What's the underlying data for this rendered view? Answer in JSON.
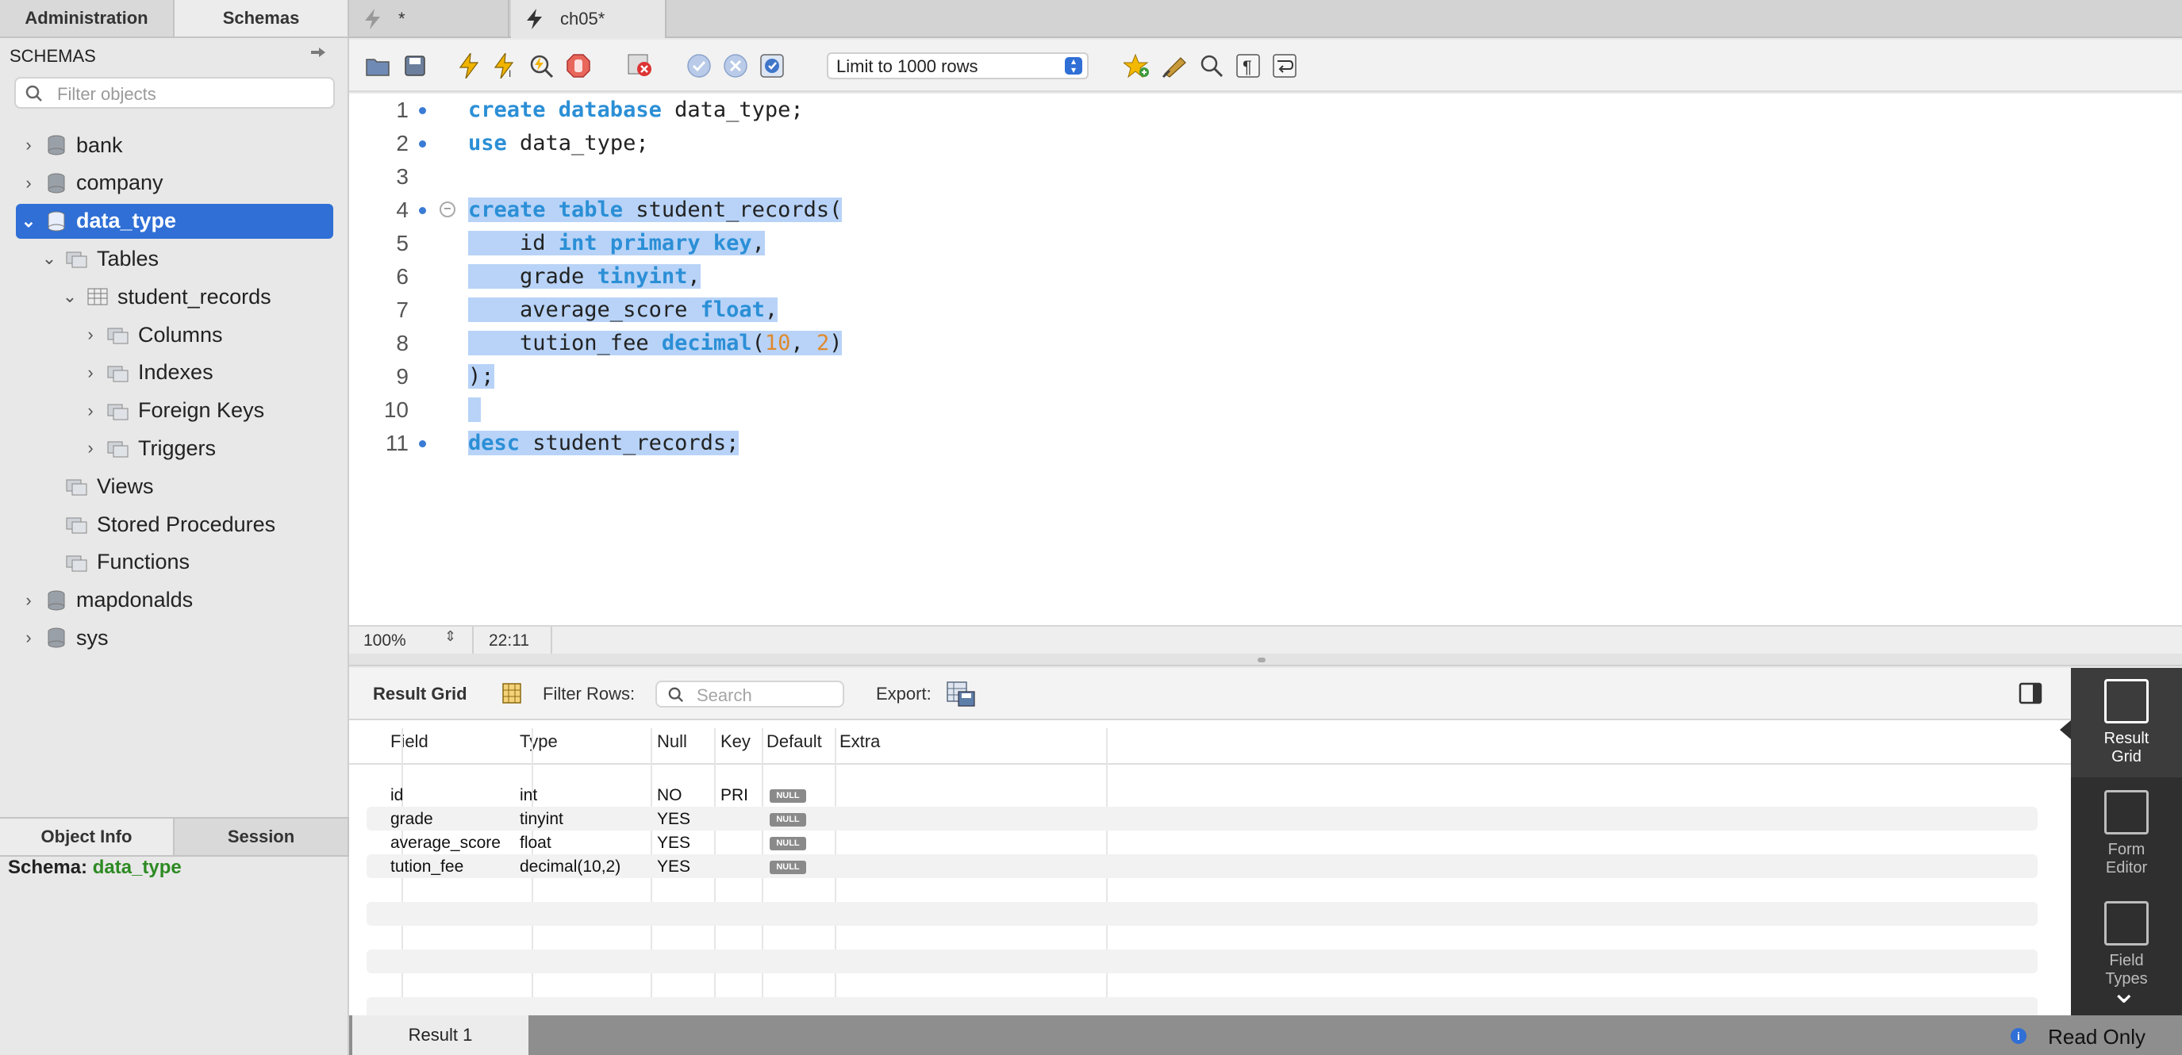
{
  "sidebar": {
    "tabs": [
      "Administration",
      "Schemas"
    ],
    "header": "SCHEMAS",
    "filter_placeholder": "Filter objects",
    "tree": [
      {
        "label": "bank",
        "level": 0,
        "expanded": false
      },
      {
        "label": "company",
        "level": 0,
        "expanded": false
      },
      {
        "label": "data_type",
        "level": 0,
        "expanded": true,
        "selected": true
      },
      {
        "label": "Tables",
        "level": 1,
        "expanded": true
      },
      {
        "label": "student_records",
        "level": 2,
        "expanded": true
      },
      {
        "label": "Columns",
        "level": 3,
        "expanded": false
      },
      {
        "label": "Indexes",
        "level": 3,
        "expanded": false
      },
      {
        "label": "Foreign Keys",
        "level": 3,
        "expanded": false
      },
      {
        "label": "Triggers",
        "level": 3,
        "expanded": false
      },
      {
        "label": "Views",
        "level": 1
      },
      {
        "label": "Stored Procedures",
        "level": 1
      },
      {
        "label": "Functions",
        "level": 1
      },
      {
        "label": "mapdonalds",
        "level": 0,
        "expanded": false
      },
      {
        "label": "sys",
        "level": 0,
        "expanded": false
      }
    ],
    "info_tabs": [
      "Object Info",
      "Session"
    ],
    "info_label": "Schema:",
    "info_value": "data_type"
  },
  "doc_tabs": [
    "*",
    "ch05*"
  ],
  "toolbar": {
    "limit_label": "Limit to 1000 rows",
    "icons": [
      "open-folder-icon",
      "save-icon",
      "execute-icon",
      "execute-current-icon",
      "explain-icon",
      "stop-icon",
      "toggle-error-icon",
      "commit-icon",
      "rollback-icon",
      "autocommit-icon",
      "favorite-icon",
      "beautify-icon",
      "find-icon",
      "invisible-chars-icon",
      "wrap-icon"
    ]
  },
  "editor": {
    "lines": [
      {
        "n": "1",
        "marker": true
      },
      {
        "n": "2",
        "marker": true
      },
      {
        "n": "3",
        "marker": false
      },
      {
        "n": "4",
        "marker": true
      },
      {
        "n": "5",
        "marker": false
      },
      {
        "n": "6",
        "marker": false
      },
      {
        "n": "7",
        "marker": false
      },
      {
        "n": "8",
        "marker": false
      },
      {
        "n": "9",
        "marker": false
      },
      {
        "n": "10",
        "marker": false
      },
      {
        "n": "11",
        "marker": true
      }
    ],
    "code": [
      [
        [
          "kw",
          "create database"
        ],
        [
          "t",
          " data_type;"
        ]
      ],
      [
        [
          "kw",
          "use"
        ],
        [
          "t",
          " data_type;"
        ]
      ],
      [],
      [
        [
          "kw",
          "create table"
        ],
        [
          "t",
          " student_records("
        ]
      ],
      [
        [
          "t",
          "    id "
        ],
        [
          "kw",
          "int primary key"
        ],
        [
          "t",
          ","
        ]
      ],
      [
        [
          "t",
          "    grade "
        ],
        [
          "kw",
          "tinyint"
        ],
        [
          "t",
          ","
        ]
      ],
      [
        [
          "t",
          "    average_score "
        ],
        [
          "kw",
          "float"
        ],
        [
          "t",
          ","
        ]
      ],
      [
        [
          "t",
          "    tution_fee "
        ],
        [
          "kw",
          "decimal"
        ],
        [
          "t",
          "("
        ],
        [
          "num",
          "10"
        ],
        [
          "t",
          ", "
        ],
        [
          "num",
          "2"
        ],
        [
          "t",
          ")"
        ]
      ],
      [
        [
          "t",
          ");"
        ]
      ],
      [
        [
          "t",
          " "
        ]
      ],
      [
        [
          "kw",
          "desc"
        ],
        [
          "t",
          " student_records;"
        ]
      ]
    ],
    "zoom": "100%",
    "cursor_pos": "22:11"
  },
  "result": {
    "grid_label": "Result Grid",
    "filter_label": "Filter Rows:",
    "search_placeholder": "Search",
    "export_label": "Export:",
    "columns": [
      "Field",
      "Type",
      "Null",
      "Key",
      "Default",
      "Extra"
    ],
    "rows": [
      [
        "id",
        "int",
        "NO",
        "PRI",
        "NULL",
        ""
      ],
      [
        "grade",
        "tinyint",
        "YES",
        "",
        "NULL",
        ""
      ],
      [
        "average_score",
        "float",
        "YES",
        "",
        "NULL",
        ""
      ],
      [
        "tution_fee",
        "decimal(10,2)",
        "YES",
        "",
        "NULL",
        ""
      ]
    ],
    "side_panel": [
      {
        "label": "Result Grid",
        "active": true
      },
      {
        "label": "Form Editor",
        "active": false
      },
      {
        "label": "Field Types",
        "active": false
      }
    ],
    "result_tab": "Result 1",
    "status": "Read Only"
  }
}
